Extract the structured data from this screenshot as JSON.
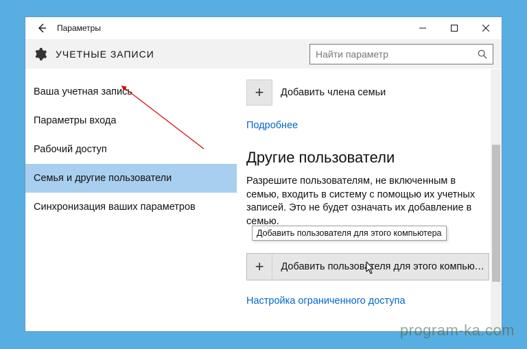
{
  "window": {
    "title": "Параметры"
  },
  "header": {
    "title": "УЧЕТНЫЕ ЗАПИСИ"
  },
  "search": {
    "placeholder": "Найти параметр"
  },
  "sidebar": {
    "items": [
      {
        "label": "Ваша учетная запись"
      },
      {
        "label": "Параметры входа"
      },
      {
        "label": "Рабочий доступ"
      },
      {
        "label": "Семья и другие пользователи"
      },
      {
        "label": "Синхронизация ваших параметров"
      }
    ],
    "selectedIndex": 3
  },
  "content": {
    "add_family_label": "Добавить члена семьи",
    "more_link": "Подробнее",
    "section_title": "Другие пользователи",
    "section_text": "Разрешите пользователям, не включенным в семью, входить в систему с помощью их учетных записей. Это не будет означать их добавление в семью.",
    "add_user_label": "Добавить пользователя для этого компьют…",
    "tooltip_text": "Добавить пользователя для этого компьютера",
    "restricted_link": "Настройка ограниченного доступа"
  },
  "watermark": "program-ka.com"
}
